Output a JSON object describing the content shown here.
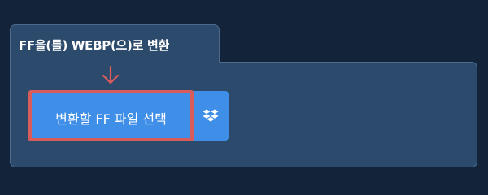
{
  "tab": {
    "title": "FF을(를) WEBP(으)로 변환"
  },
  "convert_button": {
    "label": "변환할 FF 파일 선택"
  },
  "dropbox_button": {
    "icon": "dropbox-icon"
  },
  "colors": {
    "page_background": "#13233a",
    "panel_background": "#2c4a6b",
    "button_blue": "#3f8ee8",
    "highlight_red": "#d95c5c"
  }
}
